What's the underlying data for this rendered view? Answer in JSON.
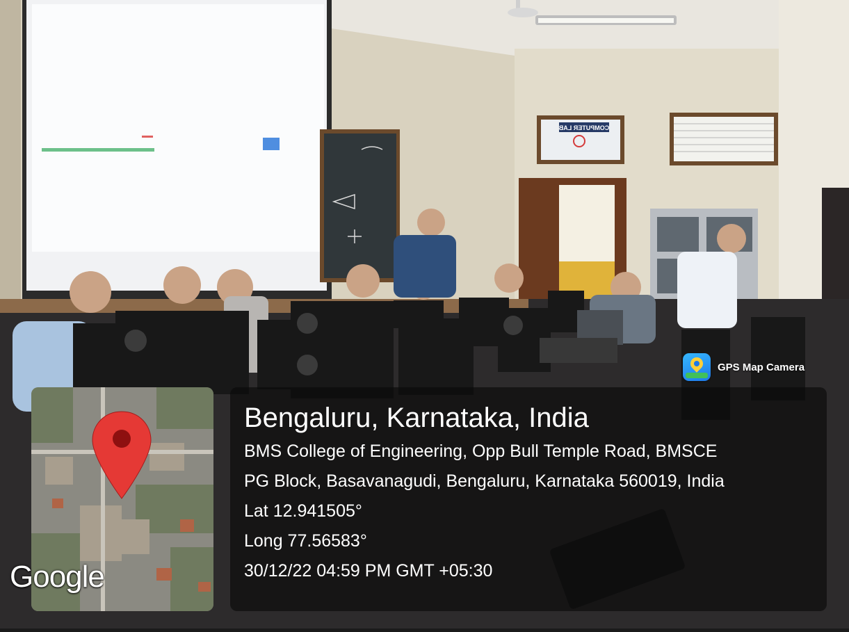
{
  "overlay": {
    "app_badge": {
      "icon": "map-pin-icon",
      "label": "GPS Map Camera"
    },
    "map_attribution": "Google",
    "location": {
      "city": "Bengaluru, Karnataka, India",
      "address_line_1": "BMS College of Engineering, Opp Bull Temple Road, BMSCE",
      "address_line_2": "PG Block, Basavanagudi, Bengaluru, Karnataka 560019, India",
      "latitude": "Lat 12.941505°",
      "longitude": "Long 77.56583°",
      "timestamp": "30/12/22 04:59 PM GMT +05:30"
    }
  },
  "scene": {
    "signage": "COMPUTER LAB"
  },
  "colors": {
    "pin_red": "#e53935",
    "overlay_bg": "#080808",
    "badge_blue": "#1e78e8"
  }
}
